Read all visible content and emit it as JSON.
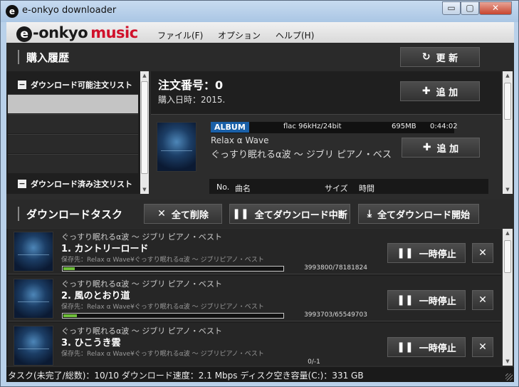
{
  "window": {
    "icon_glyph": "e",
    "title": "e-onkyo downloader",
    "minimize_glyph": "▭",
    "maximize_glyph": "▢",
    "close_glyph": "✕"
  },
  "logo": {
    "e": "e",
    "onkyo": "-onkyo",
    "music": "music"
  },
  "menu": [
    {
      "label": "ファイル(F)"
    },
    {
      "label": "オプション"
    },
    {
      "label": "ヘルプ(H)"
    }
  ],
  "purchase": {
    "title": "購入履歴",
    "refresh_icon": "refresh-icon",
    "refresh_label": "更 新",
    "lists": [
      {
        "label": "ダウンロード可能注文リスト"
      },
      {
        "label": "ダウンロード済み注文リスト"
      }
    ]
  },
  "order": {
    "number": "注文番号：0",
    "date": "購入日時：2015.",
    "add_label": "追 加",
    "album": {
      "badge": "ALBUM",
      "format": "flac 96kHz/24bit",
      "size": "695MB",
      "duration": "0:44:02",
      "artist": "Relax α Wave",
      "title": "ぐっすり眠れるα波 ～ ジブリ ピアノ・ベス",
      "add_label": "追 加"
    },
    "track_headers": {
      "no": "No.",
      "title": "曲名",
      "size": "サイズ",
      "time": "時間"
    }
  },
  "tasks": {
    "title": "ダウンロードタスク",
    "delete_all_label": "全て削除",
    "pause_all_label": "全てダウンロード中断",
    "start_all_label": "全てダウンロード開始",
    "items": [
      {
        "album": "ぐっすり眠れるα波 ～ ジブリ ピアノ・ベスト",
        "title": "1. カントリーロード",
        "path": "保存先：Relax α Wave¥ぐっすり眠れるα波 ～ ジブリピアノ・ベスト",
        "bytes": "3993800/78181824",
        "progress": 0.051,
        "pause_label": "一時停止"
      },
      {
        "album": "ぐっすり眠れるα波 ～ ジブリ ピアノ・ベスト",
        "title": "2. 風のとおり道",
        "path": "保存先：Relax α Wave¥ぐっすり眠れるα波 ～ ジブリピアノ・ベスト",
        "bytes": "3993703/65549703",
        "progress": 0.061,
        "pause_label": "一時停止"
      },
      {
        "album": "ぐっすり眠れるα波 ～ ジブリ ピアノ・ベスト",
        "title": "3. ひこうき雲",
        "path": "保存先：Relax α Wave¥ぐっすり眠れるα波 ～ ジブリピアノ・ベスト",
        "bytes": "0/-1",
        "progress": 0,
        "pause_label": "一時停止"
      }
    ]
  },
  "status": {
    "text": "タスク(未完了/総数)：10/10  ダウンロード速度：2.1 Mbps  ディスク空き容量(C:)：331 GB"
  },
  "colors": {
    "accent_green": "#6fbf3a",
    "album_badge": "#1a60a8",
    "logo_red": "#d0112b"
  }
}
